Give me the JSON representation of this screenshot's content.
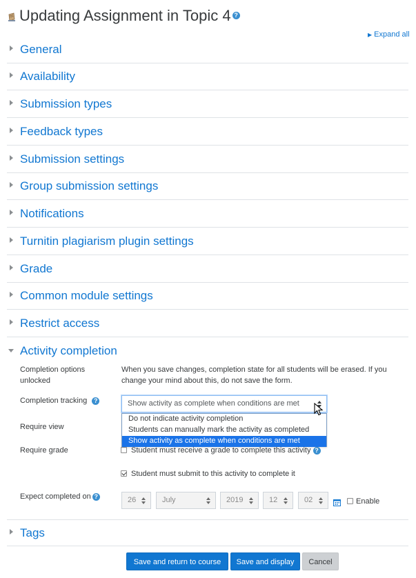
{
  "page": {
    "title": "Updating Assignment in Topic 4",
    "expand_all": "Expand all"
  },
  "sections": [
    {
      "label": "General"
    },
    {
      "label": "Availability"
    },
    {
      "label": "Submission types"
    },
    {
      "label": "Feedback types"
    },
    {
      "label": "Submission settings"
    },
    {
      "label": "Group submission settings"
    },
    {
      "label": "Notifications"
    },
    {
      "label": "Turnitin plagiarism plugin settings"
    },
    {
      "label": "Grade"
    },
    {
      "label": "Common module settings"
    },
    {
      "label": "Restrict access"
    },
    {
      "label": "Activity completion"
    }
  ],
  "completion": {
    "options_label_line1": "Completion options",
    "options_label_line2": "unlocked",
    "options_text_line1": "When you save changes, completion state for all students will be erased. If you",
    "options_text_line2": "change your mind about this, do not save the form.",
    "tracking_label": "Completion tracking",
    "tracking_value": "Show activity as complete when conditions are met",
    "tracking_options": [
      "Do not indicate activity completion",
      "Students can manually mark the activity as completed",
      "Show activity as complete when conditions are met"
    ],
    "require_view_label": "Require view",
    "require_grade_label": "Require grade",
    "require_grade_text": "Student must receive a grade to complete this activity",
    "require_submit_text": "Student must submit to this activity to complete it",
    "expect_label": "Expect completed on",
    "expect_day": "26",
    "expect_month": "July",
    "expect_year": "2019",
    "expect_hour": "12",
    "expect_minute": "02",
    "enable_label": "Enable"
  },
  "tags_section": {
    "label": "Tags"
  },
  "buttons": {
    "save_return": "Save and return to course",
    "save_display": "Save and display",
    "cancel": "Cancel"
  },
  "colors": {
    "link": "#1177d1",
    "primary_button": "#1177d1",
    "selected_option": "#1a73e8"
  }
}
